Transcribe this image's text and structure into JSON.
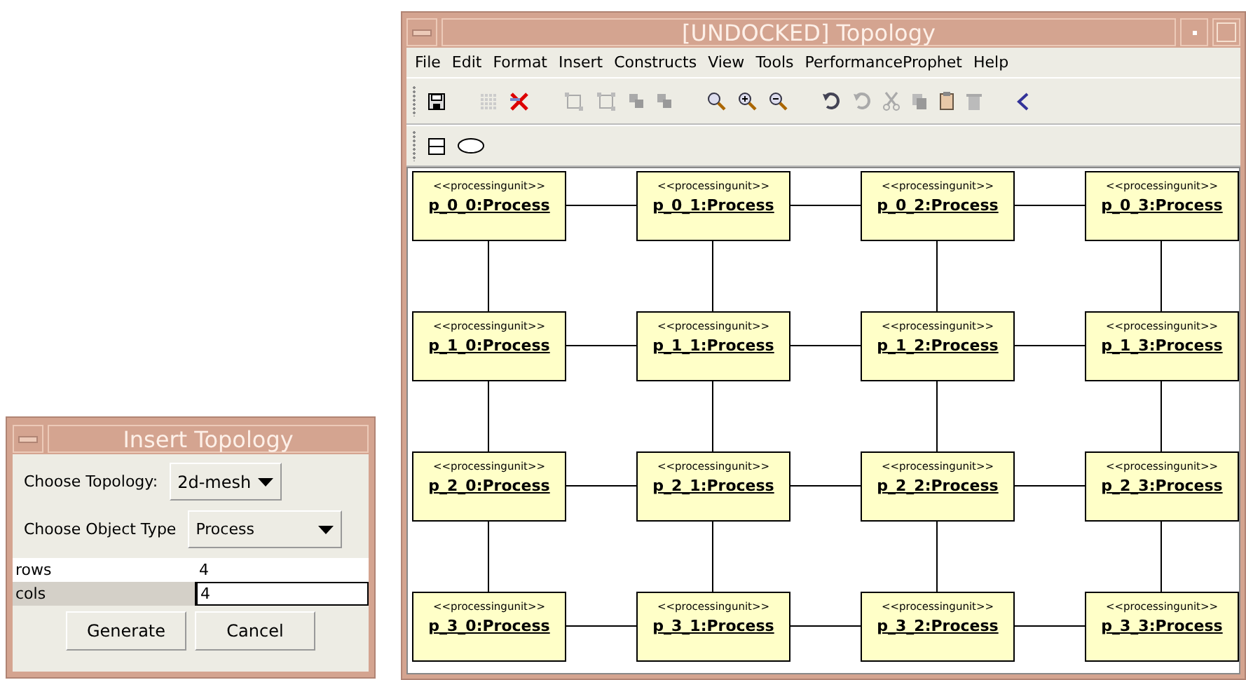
{
  "topology_window": {
    "title": "[UNDOCKED] Topology",
    "menu": [
      "File",
      "Edit",
      "Format",
      "Insert",
      "Constructs",
      "View",
      "Tools",
      "PerformanceProphet",
      "Help"
    ],
    "nodes": [
      [
        {
          "stereotype": "<<processingunit>>",
          "name": "p_0_0:Process"
        },
        {
          "stereotype": "<<processingunit>>",
          "name": "p_0_1:Process"
        },
        {
          "stereotype": "<<processingunit>>",
          "name": "p_0_2:Process"
        },
        {
          "stereotype": "<<processingunit>>",
          "name": "p_0_3:Process"
        }
      ],
      [
        {
          "stereotype": "<<processingunit>>",
          "name": "p_1_0:Process"
        },
        {
          "stereotype": "<<processingunit>>",
          "name": "p_1_1:Process"
        },
        {
          "stereotype": "<<processingunit>>",
          "name": "p_1_2:Process"
        },
        {
          "stereotype": "<<processingunit>>",
          "name": "p_1_3:Process"
        }
      ],
      [
        {
          "stereotype": "<<processingunit>>",
          "name": "p_2_0:Process"
        },
        {
          "stereotype": "<<processingunit>>",
          "name": "p_2_1:Process"
        },
        {
          "stereotype": "<<processingunit>>",
          "name": "p_2_2:Process"
        },
        {
          "stereotype": "<<processingunit>>",
          "name": "p_2_3:Process"
        }
      ],
      [
        {
          "stereotype": "<<processingunit>>",
          "name": "p_3_0:Process"
        },
        {
          "stereotype": "<<processingunit>>",
          "name": "p_3_1:Process"
        },
        {
          "stereotype": "<<processingunit>>",
          "name": "p_3_2:Process"
        },
        {
          "stereotype": "<<processingunit>>",
          "name": "p_3_3:Process"
        }
      ]
    ]
  },
  "insert_dialog": {
    "title": "Insert Topology",
    "topology_label": "Choose Topology:",
    "topology_value": "2d-mesh",
    "object_type_label": "Choose Object Type",
    "object_type_value": "Process",
    "params": [
      {
        "name": "rows",
        "value": "4",
        "selected": false
      },
      {
        "name": "cols",
        "value": "4",
        "selected": true
      }
    ],
    "buttons": [
      "Generate",
      "Cancel"
    ]
  }
}
